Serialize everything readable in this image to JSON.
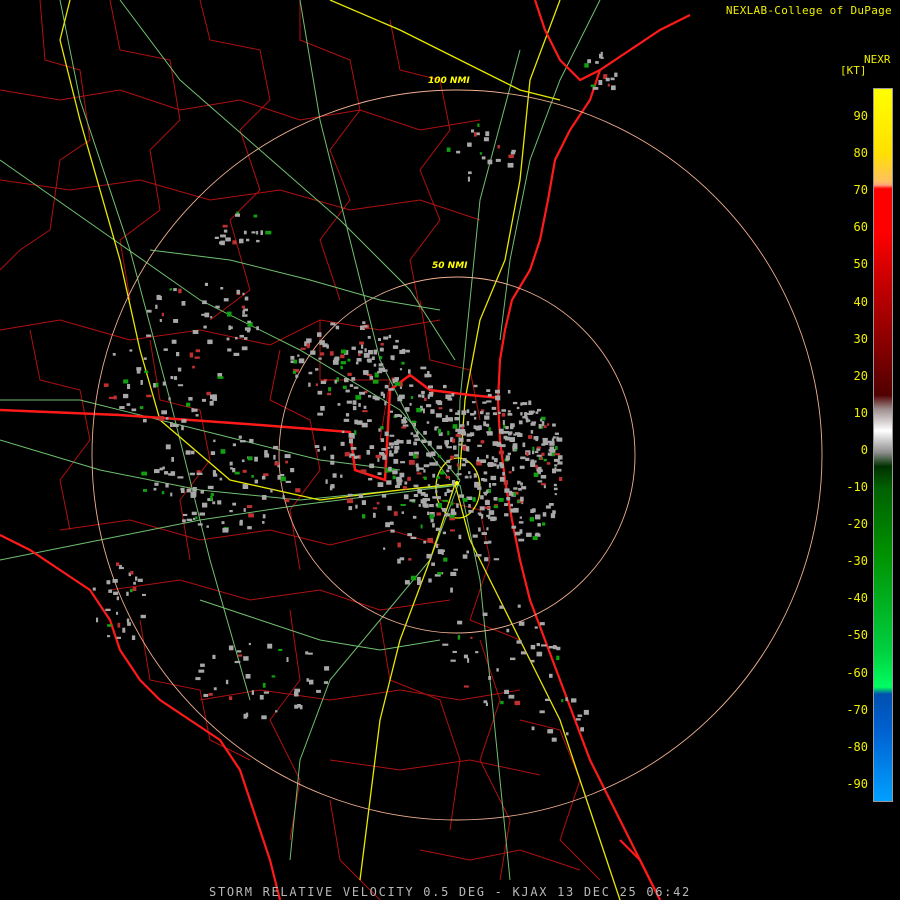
{
  "header": {
    "credit": "NEXLAB-College of DuPage",
    "product_code": "NEXR",
    "unit": "[KT]"
  },
  "legend": {
    "ticks": [
      "90",
      "80",
      "70",
      "60",
      "50",
      "40",
      "30",
      "20",
      "10",
      "0",
      "-10",
      "-20",
      "-30",
      "-40",
      "-50",
      "-60",
      "-70",
      "-80",
      "-90"
    ]
  },
  "map": {
    "range_rings": [
      "100 NMI",
      "50 NMI"
    ],
    "colors": {
      "state_lines": "#ff1a1a",
      "county_lines": "#b01010",
      "highways_major": "#e8e800",
      "highways_minor": "#70c070",
      "range_rings": "#f0b090",
      "echo_gray": "#a8a8a8",
      "echo_green": "#10a010",
      "echo_red": "#c03030"
    }
  },
  "footer": {
    "caption": "STORM RELATIVE VELOCITY 0.5 DEG - KJAX 13 DEC 25 06:42"
  }
}
